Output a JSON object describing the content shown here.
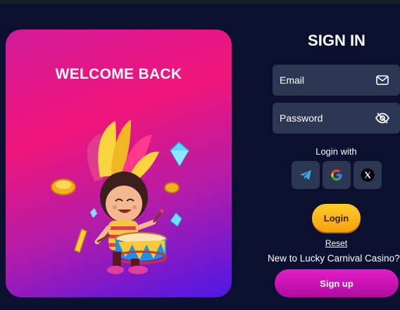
{
  "promo": {
    "heading": "WELCOME BACK"
  },
  "signin": {
    "title": "SIGN IN",
    "email_label": "Email",
    "email_icon": "envelope-icon",
    "password_label": "Password",
    "password_icon": "eye-off-icon",
    "login_with": "Login with",
    "social": [
      {
        "name": "telegram",
        "icon": "telegram-icon"
      },
      {
        "name": "google",
        "icon": "google-icon"
      },
      {
        "name": "x",
        "icon": "x-icon"
      }
    ],
    "login_label": "Login",
    "reset_label": "Reset",
    "new_to": "New to Lucky Carnival Casino?",
    "signup_label": "Sign up"
  },
  "colors": {
    "background": "#0b1030",
    "field": "#2b3754",
    "login": "#ffcb2b",
    "signup": "#e21fc5"
  }
}
